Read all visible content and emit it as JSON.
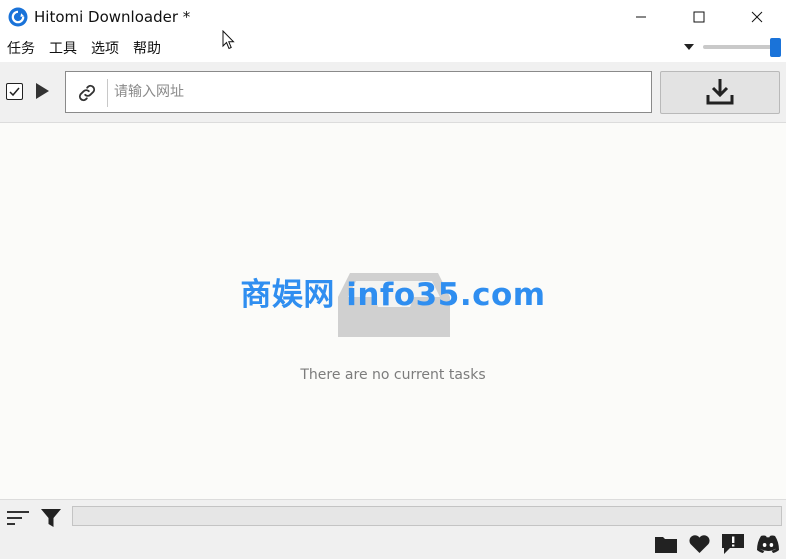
{
  "window": {
    "title": "Hitomi Downloader *"
  },
  "menu": {
    "items": [
      "任务",
      "工具",
      "选项",
      "帮助"
    ]
  },
  "url_input": {
    "placeholder": "请输入网址",
    "value": ""
  },
  "main": {
    "empty_message": "There are no current tasks",
    "watermark": "商娱网 info35.com"
  },
  "volume": {
    "level": 1.0
  },
  "colors": {
    "accent": "#1a73d9",
    "watermark": "#2f8ef0",
    "empty_icon": "#d0d0d0"
  }
}
